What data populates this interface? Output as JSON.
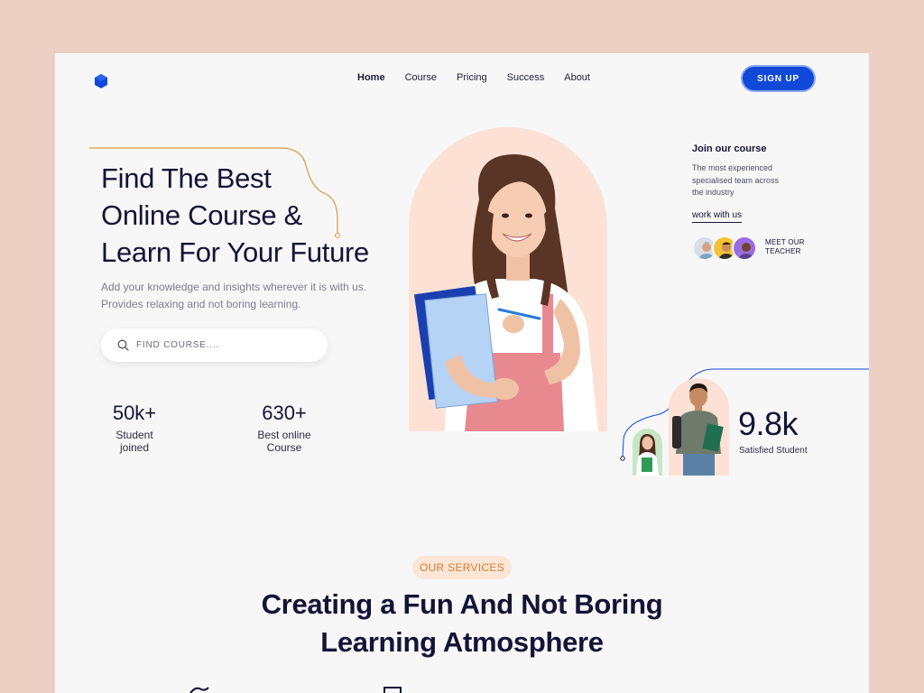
{
  "nav": {
    "items": [
      "Home",
      "Course",
      "Pricing",
      "Success",
      "About"
    ],
    "active": "Home",
    "signup_label": "SIGN UP"
  },
  "hero": {
    "title_lines": [
      "Find The Best",
      "Online Course &",
      "Learn For Your Future"
    ],
    "description": "Add your knowledge and insights wherever it is with us. Provides relaxing and not boring learning.",
    "search_placeholder": "FIND COURSE....",
    "stats": [
      {
        "value": "50k+",
        "label": "Student joined"
      },
      {
        "value": "630+",
        "label": "Best online Course"
      }
    ]
  },
  "join": {
    "title": "Join our course",
    "description": "The most experienced specialised team across the industry",
    "link": "work with us",
    "meet_lines": [
      "MEET OUR",
      "TEACHER"
    ]
  },
  "satisfied": {
    "value": "9.8k",
    "label": "Satisfied Student"
  },
  "services": {
    "badge": "OUR SERVICES",
    "title_lines": [
      "Creating a Fun And Not Boring",
      "Learning Atmosphere"
    ]
  },
  "colors": {
    "primary": "#1048d8",
    "accent_orange": "#e0953f",
    "peach": "#fde1d4",
    "dark_text": "#141437",
    "background": "#ecd0c3"
  }
}
